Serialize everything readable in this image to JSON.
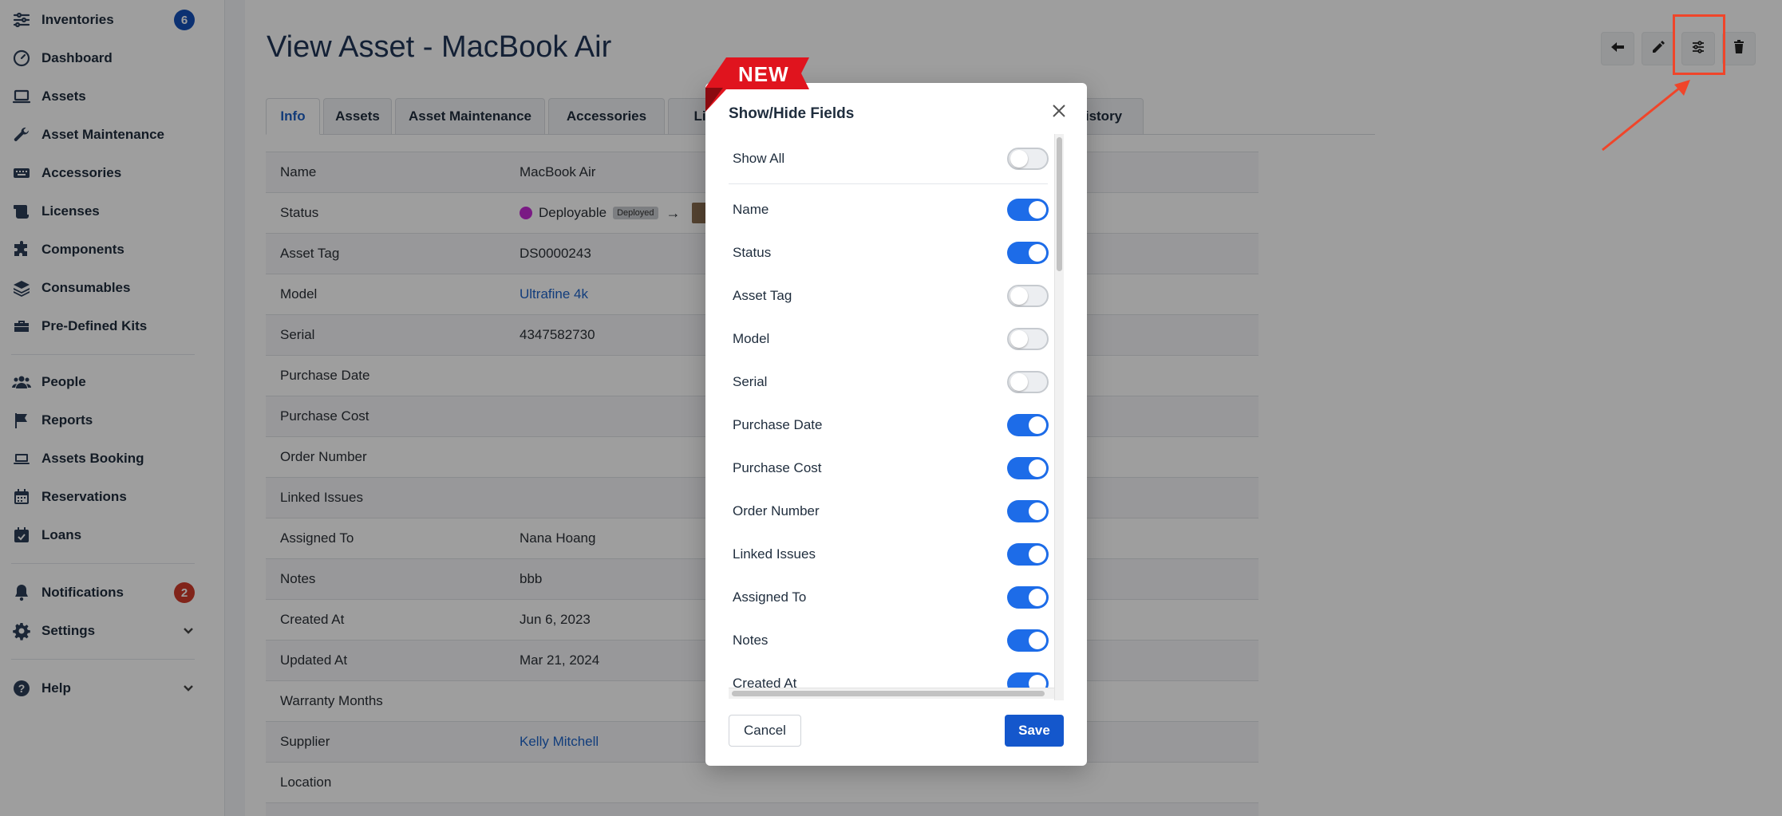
{
  "colors": {
    "accent": "#1d6ce8",
    "save": "#1457cc",
    "badge_blue": "#1450b8",
    "badge_red": "#d13a2a",
    "annotation": "#f0452a",
    "ribbon": "#e0141e"
  },
  "sidebar": {
    "items": [
      {
        "label": "Inventories",
        "icon": "sliders-icon",
        "badge": "6",
        "badge_color": "blue"
      },
      {
        "label": "Dashboard",
        "icon": "gauge-icon"
      },
      {
        "label": "Assets",
        "icon": "laptop-icon"
      },
      {
        "label": "Asset Maintenance",
        "icon": "wrench-icon"
      },
      {
        "label": "Accessories",
        "icon": "keyboard-icon"
      },
      {
        "label": "Licenses",
        "icon": "scroll-icon"
      },
      {
        "label": "Components",
        "icon": "puzzle-icon"
      },
      {
        "label": "Consumables",
        "icon": "layers-icon"
      },
      {
        "label": "Pre-Defined Kits",
        "icon": "toolbox-icon"
      },
      {
        "label": "People",
        "icon": "users-icon"
      },
      {
        "label": "Reports",
        "icon": "flag-icon"
      },
      {
        "label": "Assets Booking",
        "icon": "laptop-house-icon"
      },
      {
        "label": "Reservations",
        "icon": "calendar-icon"
      },
      {
        "label": "Loans",
        "icon": "calendar-check-icon"
      },
      {
        "label": "Notifications",
        "icon": "bell-icon",
        "badge": "2",
        "badge_color": "red"
      },
      {
        "label": "Settings",
        "icon": "gear-icon",
        "chevron": true
      },
      {
        "label": "Help",
        "icon": "question-circle-icon",
        "chevron": true
      }
    ]
  },
  "main": {
    "title": "View Asset - MacBook Air",
    "tabs": [
      "Info",
      "Assets",
      "Asset Maintenance",
      "Accessories",
      "Li",
      "istory"
    ],
    "info_rows": [
      {
        "label": "Name",
        "value": "MacBook Air"
      },
      {
        "label": "Status",
        "value": "Deployable",
        "tag": "Deployed",
        "arrow": "→"
      },
      {
        "label": "Asset Tag",
        "value": "DS0000243"
      },
      {
        "label": "Model",
        "value": "Ultrafine 4k",
        "link": true
      },
      {
        "label": "Serial",
        "value": "4347582730"
      },
      {
        "label": "Purchase Date",
        "value": ""
      },
      {
        "label": "Purchase Cost",
        "value": ""
      },
      {
        "label": "Order Number",
        "value": ""
      },
      {
        "label": "Linked Issues",
        "value": ""
      },
      {
        "label": "Assigned To",
        "value": "Nana Hoang"
      },
      {
        "label": "Notes",
        "value": "bbb"
      },
      {
        "label": "Created At",
        "value": "Jun 6, 2023"
      },
      {
        "label": "Updated At",
        "value": "Mar 21, 2024"
      },
      {
        "label": "Warranty Months",
        "value": ""
      },
      {
        "label": "Supplier",
        "value": "Kelly Mitchell",
        "link": true
      },
      {
        "label": "Location",
        "value": ""
      }
    ]
  },
  "modal": {
    "title": "Show/Hide Fields",
    "ribbon": "NEW",
    "fields": [
      {
        "label": "Show All",
        "on": false
      },
      {
        "label": "Name",
        "on": true
      },
      {
        "label": "Status",
        "on": true
      },
      {
        "label": "Asset Tag",
        "on": false
      },
      {
        "label": "Model",
        "on": false
      },
      {
        "label": "Serial",
        "on": false
      },
      {
        "label": "Purchase Date",
        "on": true
      },
      {
        "label": "Purchase Cost",
        "on": true
      },
      {
        "label": "Order Number",
        "on": true
      },
      {
        "label": "Linked Issues",
        "on": true
      },
      {
        "label": "Assigned To",
        "on": true
      },
      {
        "label": "Notes",
        "on": true
      },
      {
        "label": "Created At",
        "on": true
      }
    ],
    "cancel_label": "Cancel",
    "save_label": "Save"
  }
}
